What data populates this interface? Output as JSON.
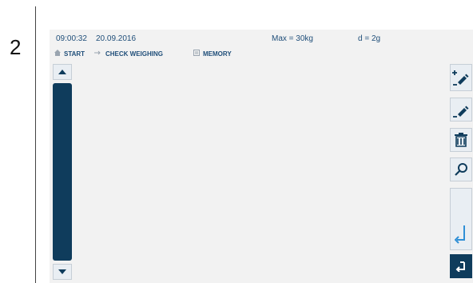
{
  "step_number": "2",
  "status": {
    "time": "09:00:32",
    "date": "20.09.2016",
    "max": "Max = 30kg",
    "d": "d = 2g"
  },
  "breadcrumb": [
    {
      "label": "START",
      "icon": "home-icon"
    },
    {
      "label": "CHECK WEIGHING",
      "icon": "arrow-icon"
    },
    {
      "label": "MEMORY",
      "icon": "memory-icon"
    }
  ],
  "colors": {
    "accent": "#0f3c5c",
    "screen_bg": "#f2f2f2",
    "button_bg": "#e9eef3",
    "text": "#1f4e79"
  },
  "side_buttons": [
    {
      "icon": "add-edit-icon"
    },
    {
      "icon": "edit-icon"
    },
    {
      "icon": "trash-icon"
    },
    {
      "icon": "search-icon"
    },
    {
      "icon": "enter-icon"
    },
    {
      "icon": "back-icon"
    }
  ]
}
